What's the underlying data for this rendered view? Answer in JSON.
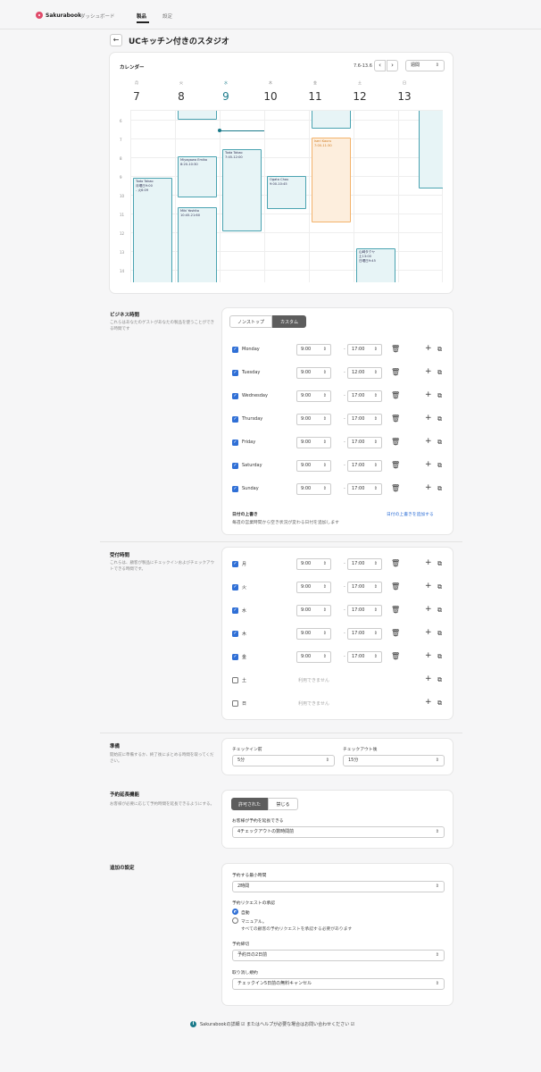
{
  "nav": {
    "logo": "Sakurabook",
    "links": [
      "ダッシュボード",
      "製品",
      "設定"
    ]
  },
  "page": {
    "title": "UCキッチン付きのスタジオ"
  },
  "calendar": {
    "title": "カレンダー",
    "range": "7.6-13.6",
    "prev_icon": "chevron-left-icon",
    "next_icon": "chevron-right-icon",
    "view": "週間",
    "days": [
      {
        "name": "月",
        "num": "7"
      },
      {
        "name": "火",
        "num": "8"
      },
      {
        "name": "水",
        "num": "9"
      },
      {
        "name": "木",
        "num": "10"
      },
      {
        "name": "金",
        "num": "11"
      },
      {
        "name": "土",
        "num": "12"
      },
      {
        "name": "日",
        "num": "13"
      }
    ],
    "hours": [
      "6",
      "7",
      "8",
      "9",
      "10",
      "11",
      "12",
      "13",
      "14"
    ],
    "events": [
      {
        "name": "Todo Takao",
        "time": "月曜日9:00",
        "extra": "- 火6:09"
      },
      {
        "name": "Miyagawa Emiko",
        "time": "8:20-10:30"
      },
      {
        "name": "Miki Yoshito",
        "time": "10:45-21:60"
      },
      {
        "name": "Toda Takao",
        "time": "7:45-12:00"
      },
      {
        "name": "Ogata Chou",
        "time": "9:00-10:45"
      },
      {
        "name": "Iseri Kaoru",
        "time": "7:00-11:30"
      },
      {
        "name": "山崎タクヤ",
        "time": "土13:00",
        "extra": "日曜日9:45"
      }
    ]
  },
  "business_hours": {
    "title": "ビジネス時間",
    "desc": "これらはあなたのゲストがあなたの製品を使うことができる時間です",
    "mode_options": [
      "ノンストップ",
      "カスタム"
    ],
    "days": [
      {
        "label": "Monday",
        "from": "9:00",
        "to": "17:00"
      },
      {
        "label": "Tuesday",
        "from": "9:00",
        "to": "12:00"
      },
      {
        "label": "Wednesday",
        "from": "9:00",
        "to": "17:00"
      },
      {
        "label": "Thursday",
        "from": "9:00",
        "to": "17:00"
      },
      {
        "label": "Friday",
        "from": "9:00",
        "to": "17:00"
      },
      {
        "label": "Saturday",
        "from": "9:00",
        "to": "17:00"
      },
      {
        "label": "Sunday",
        "from": "9:00",
        "to": "17:00"
      }
    ],
    "override_title": "日付の上書き",
    "override_desc": "毎週の営業時間から空き状況が変わる日付を追加します",
    "override_link": "日付の上書きを追加する"
  },
  "reception_hours": {
    "title": "受付時間",
    "desc": "これらは、顧客が製品にチェックインおよびチェックアウトできる時間です。",
    "unavailable": "利用できません",
    "days": [
      {
        "label": "月",
        "from": "9:00",
        "to": "17:00"
      },
      {
        "label": "火",
        "from": "9:00",
        "to": "17:00"
      },
      {
        "label": "水",
        "from": "9:00",
        "to": "17:00"
      },
      {
        "label": "木",
        "from": "9:00",
        "to": "17:00"
      },
      {
        "label": "金",
        "from": "9:00",
        "to": "17:00"
      },
      {
        "label": "土"
      },
      {
        "label": "日"
      }
    ]
  },
  "prep": {
    "title": "準備",
    "desc": "開始前に準備するか、終了後にまとめる時間を取ってください。",
    "checkin_label": "チェックイン前",
    "checkin_value": "5分",
    "checkout_label": "チェックアウト後",
    "checkout_value": "15分"
  },
  "extension": {
    "title": "予約延長機能",
    "desc": "お客様が必要に応じて予約時間を延長できるようにする。",
    "options": [
      "許可された",
      "禁じる"
    ],
    "field_label": "お客様が予約を延長できる",
    "field_value": "4チェックアウトの数時間前"
  },
  "additional": {
    "title": "追加の設定",
    "min_label": "予約する最小時間",
    "min_value": "2時間",
    "approval_label": "予約リクエストの承認",
    "auto_label": "自動",
    "manual_label": "マニュアル。",
    "manual_desc": "すべての顧客の予約リクエストを承認する必要があります",
    "deadline_label": "予約締切",
    "deadline_value": "予約日の2日前",
    "cancel_label": "取り消し規約",
    "cancel_value": "チェックイン5日前の無料キャンセル"
  },
  "footer": {
    "text": "Sakurabookの詳細 ☑ またはヘルプが必要な場合はお問い合わせください ☑"
  }
}
